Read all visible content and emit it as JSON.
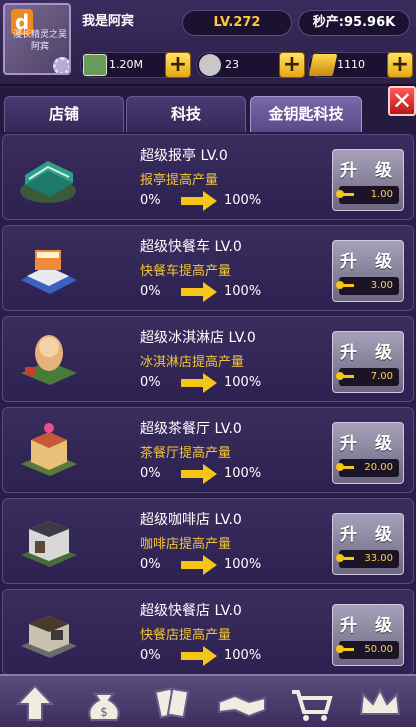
{
  "player": {
    "name": "我是阿宾",
    "level": "LV.272",
    "production": "秒产:95.96K",
    "avatar_logo": "d",
    "avatar_watermark": "漫长精灵之吴阿宾"
  },
  "resources": [
    {
      "icon": "money-icon",
      "value": "1.20M"
    },
    {
      "icon": "money-bag-icon",
      "value": "23"
    },
    {
      "icon": "gold-bar-icon",
      "value": "1110"
    }
  ],
  "tabs": [
    {
      "label": "店铺",
      "active": false
    },
    {
      "label": "科技",
      "active": false
    },
    {
      "label": "金钥匙科技",
      "active": true
    }
  ],
  "close_label": "✕",
  "items": [
    {
      "title": "超级报亭 LV.0",
      "desc": "报亭提高产量",
      "from": "0%",
      "to": "100%",
      "button": "升 级",
      "cost": "1.00",
      "icon": "kiosk-icon"
    },
    {
      "title": "超级快餐车 LV.0",
      "desc": "快餐车提高产量",
      "from": "0%",
      "to": "100%",
      "button": "升 级",
      "cost": "3.00",
      "icon": "food-truck-icon"
    },
    {
      "title": "超级冰淇淋店 LV.0",
      "desc": "冰淇淋店提高产量",
      "from": "0%",
      "to": "100%",
      "button": "升 级",
      "cost": "7.00",
      "icon": "ice-cream-shop-icon"
    },
    {
      "title": "超级茶餐厅 LV.0",
      "desc": "茶餐厅提高产量",
      "from": "0%",
      "to": "100%",
      "button": "升 级",
      "cost": "20.00",
      "icon": "tea-restaurant-icon"
    },
    {
      "title": "超级咖啡店 LV.0",
      "desc": "咖啡店提高产量",
      "from": "0%",
      "to": "100%",
      "button": "升 级",
      "cost": "33.00",
      "icon": "coffee-shop-icon"
    },
    {
      "title": "超级快餐店 LV.0",
      "desc": "快餐店提高产量",
      "from": "0%",
      "to": "100%",
      "button": "升 级",
      "cost": "50.00",
      "icon": "fast-food-shop-icon"
    }
  ],
  "bottom_nav": [
    {
      "icon": "up-arrow-icon"
    },
    {
      "icon": "money-bag-icon"
    },
    {
      "icon": "cards-icon"
    },
    {
      "icon": "handshake-icon"
    },
    {
      "icon": "shopping-cart-icon"
    },
    {
      "icon": "crown-icon"
    }
  ],
  "colors": {
    "accent_gold": "#f3c53a",
    "background": "#2a1e4a",
    "close_red": "#d82020"
  }
}
